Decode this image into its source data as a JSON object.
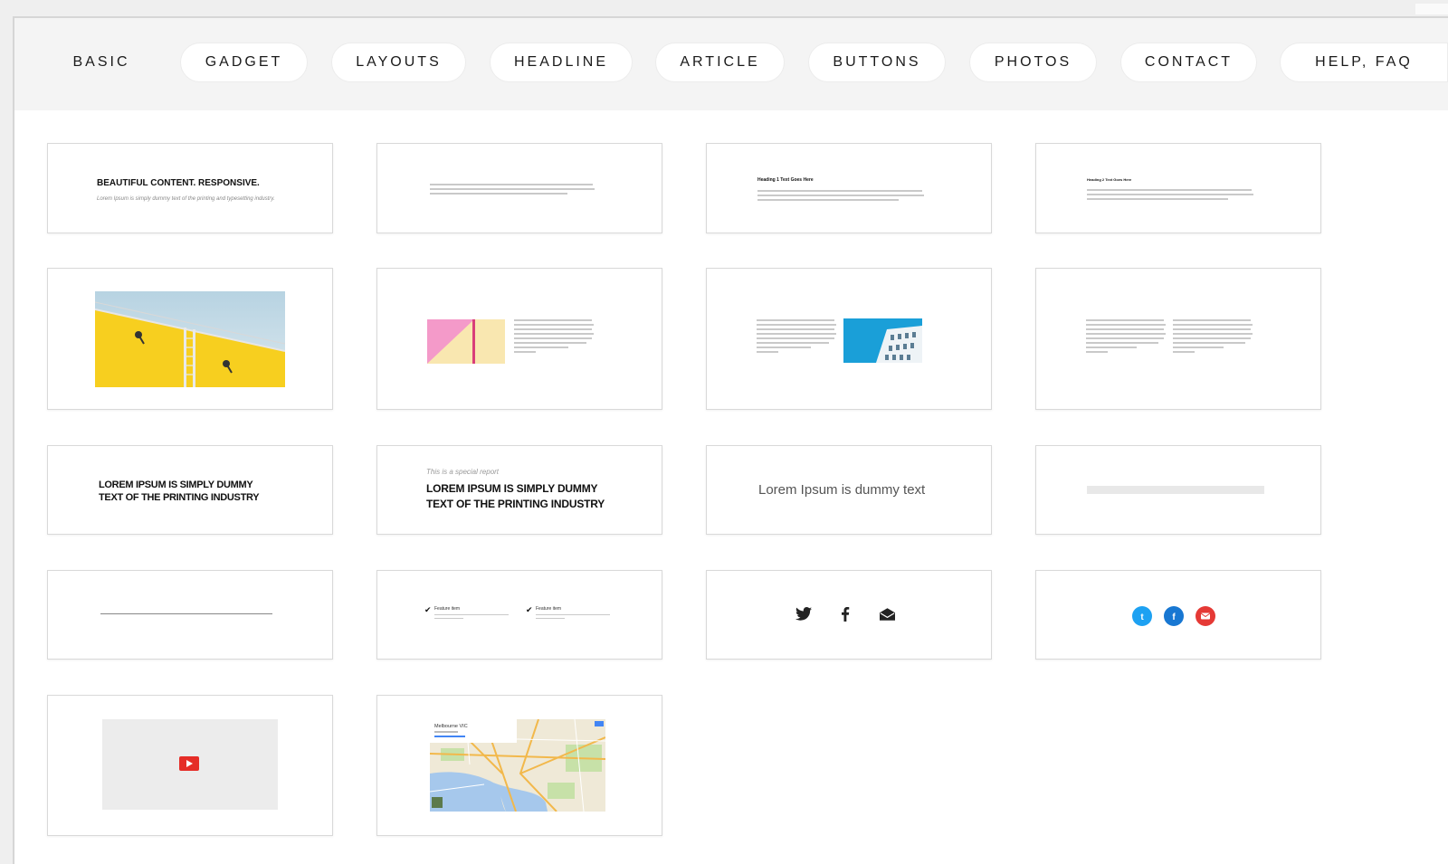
{
  "tabs": [
    {
      "label": "BASIC"
    },
    {
      "label": "GADGET"
    },
    {
      "label": "LAYOUTS"
    },
    {
      "label": "HEADLINE"
    },
    {
      "label": "ARTICLE"
    },
    {
      "label": "BUTTONS"
    },
    {
      "label": "PHOTOS"
    },
    {
      "label": "CONTACT"
    },
    {
      "label": "HELP, FAQ"
    }
  ],
  "cards": {
    "hero": {
      "title": "BEAUTIFUL CONTENT. RESPONSIVE.",
      "subtitle": "Lorem Ipsum is simply dummy text of the printing and typesetting industry."
    },
    "heading1": {
      "title": "Heading 1 Text Goes Here"
    },
    "heading2": {
      "title": "Heading 2 Text Goes Here"
    },
    "headline1": {
      "line1": "LOREM IPSUM IS SIMPLY DUMMY",
      "line2": "TEXT OF THE PRINTING INDUSTRY"
    },
    "headline2": {
      "kicker": "This is a special report",
      "line1": "LOREM IPSUM IS SIMPLY DUMMY",
      "line2": "TEXT OF THE PRINTING INDUSTRY"
    },
    "lead": {
      "text": "Lorem Ipsum is dummy text"
    },
    "features": {
      "item1": "Feature item",
      "item2": "Feature item"
    },
    "social": {
      "icons": [
        "twitter-icon",
        "facebook-icon",
        "mail-icon"
      ]
    },
    "social_round": {
      "icons": [
        "twitter-icon",
        "facebook-icon",
        "mail-icon"
      ],
      "colors": {
        "twitter": "#1da1f2",
        "facebook": "#1877d2",
        "mail": "#e53935"
      }
    },
    "video": {
      "icon": "youtube-play-icon",
      "color": "#e52d27"
    },
    "map": {
      "place": "Melbourne VIC"
    }
  },
  "colors": {
    "tabbar_bg": "#f4f4f4",
    "page_bg": "#efefef",
    "photo_yellow": "#f7cf1f",
    "photo_pink": "#f49ac9",
    "photo_blue": "#1a9fd8"
  }
}
